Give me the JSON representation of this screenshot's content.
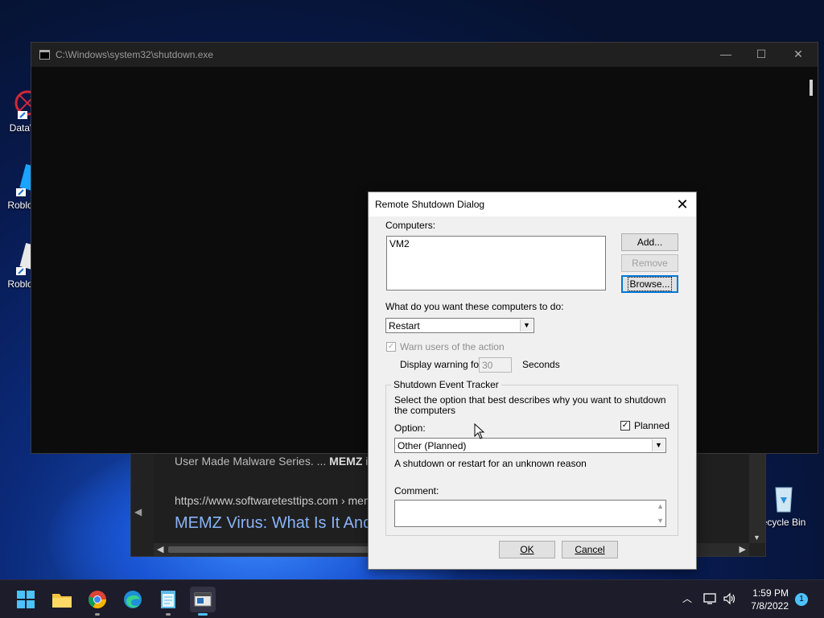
{
  "desktop": {
    "icons": [
      {
        "label": "DataW"
      },
      {
        "label": "Roblox"
      },
      {
        "label": "Roblox"
      },
      {
        "label": "ecycle Bin"
      }
    ]
  },
  "browser": {
    "snippet_prefix": "User Made Malware Series. ... ",
    "snippet_bold": "MEMZ",
    "snippet_suffix": " i",
    "url": "https://www.softwaretesttips.com › mem",
    "link": "MEMZ Virus: What Is It And"
  },
  "console": {
    "title": "C:\\Windows\\system32\\shutdown.exe"
  },
  "dialog": {
    "title": "Remote Shutdown Dialog",
    "computers_label": "Computers:",
    "computers": [
      "VM2"
    ],
    "add_label": "Add...",
    "remove_label": "Remove",
    "browse_label": "Browse...",
    "action_label": "What do you want these computers to do:",
    "action_value": "Restart",
    "warn_label": "Warn users of the action",
    "warn_checked": true,
    "display_warning_label": "Display warning for",
    "warning_seconds": "30",
    "seconds_label": "Seconds",
    "tracker_legend": "Shutdown Event Tracker",
    "tracker_desc": "Select the option that best describes why you want to shutdown the computers",
    "option_label": "Option:",
    "planned_label": "Planned",
    "planned_checked": true,
    "option_value": "Other (Planned)",
    "reason_text": "A shutdown or restart for an unknown reason",
    "comment_label": "Comment:",
    "comment_value": "",
    "ok_label": "OK",
    "cancel_label": "Cancel"
  },
  "taskbar": {
    "apps": [
      "start-icon",
      "file-explorer-icon",
      "chrome-icon",
      "edge-icon",
      "notepad-icon",
      "console-app-icon"
    ],
    "time": "1:59 PM",
    "date": "7/8/2022",
    "notification_count": "1"
  },
  "colors": {
    "accent": "#0078d7",
    "taskbar_active": "#4cc2ff"
  }
}
